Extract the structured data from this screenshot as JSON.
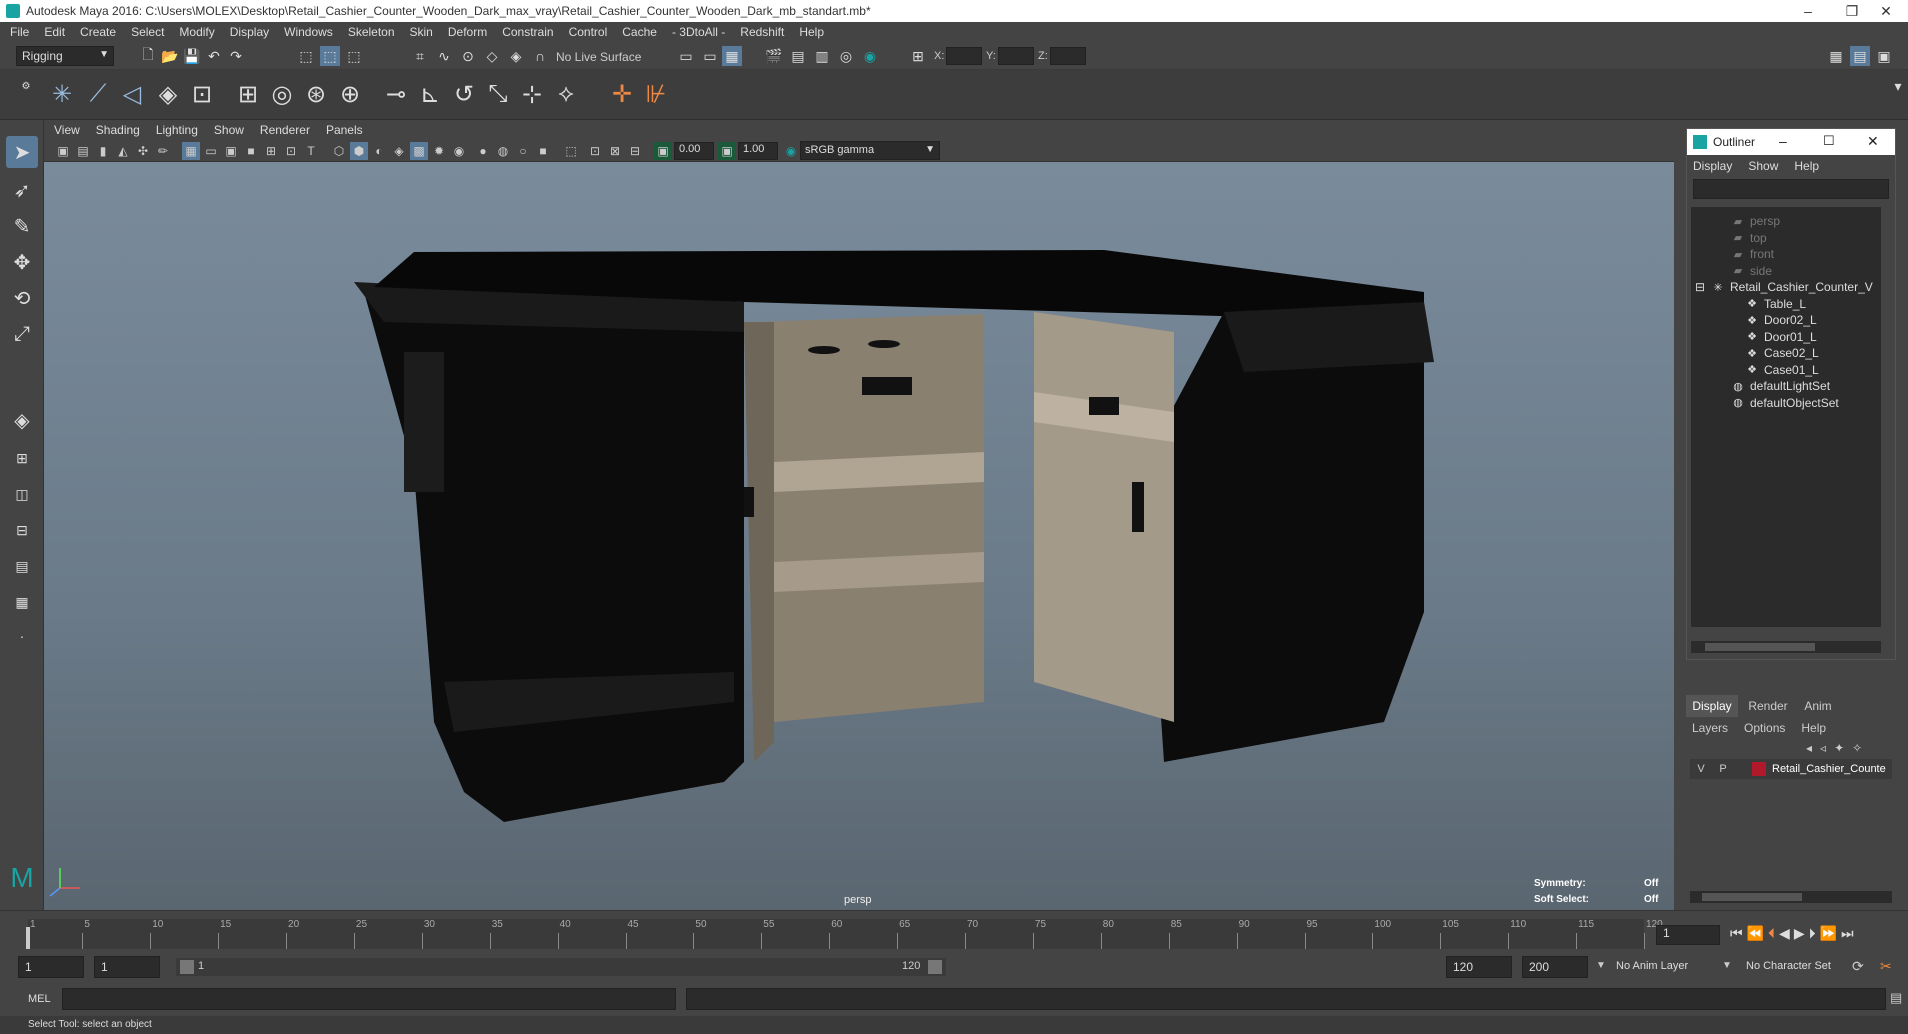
{
  "app": {
    "title": "Autodesk Maya 2016: C:\\Users\\MOLEX\\Desktop\\Retail_Cashier_Counter_Wooden_Dark_max_vray\\Retail_Cashier_Counter_Wooden_Dark_mb_standart.mb*"
  },
  "menubar": [
    "File",
    "Edit",
    "Create",
    "Select",
    "Modify",
    "Display",
    "Windows",
    "Skeleton",
    "Skin",
    "Deform",
    "Constrain",
    "Control",
    "Cache",
    "- 3DtoAll -",
    "Redshift",
    "Help"
  ],
  "statusline": {
    "mode": "Rigging",
    "live_surface": "No Live Surface",
    "x_label": "X:",
    "y_label": "Y:",
    "z_label": "Z:"
  },
  "viewport": {
    "menu": [
      "View",
      "Shading",
      "Lighting",
      "Show",
      "Renderer",
      "Panels"
    ],
    "exposure": "0.00",
    "gamma": "1.00",
    "color_space": "sRGB gamma",
    "camera_label": "persp",
    "symmetry_label": "Symmetry:",
    "symmetry_value": "Off",
    "soft_select_label": "Soft Select:",
    "soft_select_value": "Off"
  },
  "outliner": {
    "title": "Outliner",
    "menu": [
      "Display",
      "Show",
      "Help"
    ],
    "items": [
      {
        "label": "persp",
        "icon": "camera-icon",
        "dim": true
      },
      {
        "label": "top",
        "icon": "camera-icon",
        "dim": true
      },
      {
        "label": "front",
        "icon": "camera-icon",
        "dim": true
      },
      {
        "label": "side",
        "icon": "camera-icon",
        "dim": true
      },
      {
        "label": "Retail_Cashier_Counter_V",
        "icon": "group-icon",
        "dim": false
      },
      {
        "label": "Table_L",
        "icon": "mesh-icon",
        "dim": false
      },
      {
        "label": "Door02_L",
        "icon": "mesh-icon",
        "dim": false
      },
      {
        "label": "Door01_L",
        "icon": "mesh-icon",
        "dim": false
      },
      {
        "label": "Case02_L",
        "icon": "mesh-icon",
        "dim": false
      },
      {
        "label": "Case01_L",
        "icon": "mesh-icon",
        "dim": false
      },
      {
        "label": "defaultLightSet",
        "icon": "set-icon",
        "dim": false
      },
      {
        "label": "defaultObjectSet",
        "icon": "set-icon",
        "dim": false
      }
    ]
  },
  "channelbox": {
    "tabs": [
      "Display",
      "Render",
      "Anim"
    ],
    "menu": [
      "Layers",
      "Options",
      "Help"
    ],
    "layer_v": "V",
    "layer_p": "P",
    "layer_name": "Retail_Cashier_Counte",
    "layer_color": "#b0192a"
  },
  "timeline": {
    "ticks": [
      "1",
      "5",
      "10",
      "15",
      "20",
      "25",
      "30",
      "35",
      "40",
      "45",
      "50",
      "55",
      "60",
      "65",
      "70",
      "75",
      "80",
      "85",
      "90",
      "95",
      "100",
      "105",
      "110",
      "115",
      "120"
    ],
    "current_frame": "1"
  },
  "range": {
    "start": "1",
    "start2": "1",
    "slider_start": "1",
    "slider_end": "120",
    "end": "120",
    "end2": "200",
    "anim_layer": "No Anim Layer",
    "char_set": "No Character Set"
  },
  "cmdline": {
    "lang": "MEL"
  },
  "helpline": {
    "text": "Select Tool: select an object"
  }
}
